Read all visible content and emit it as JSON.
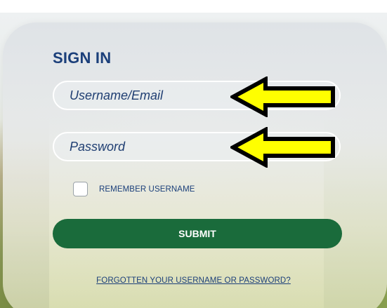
{
  "form": {
    "title": "SIGN IN",
    "username_placeholder": "Username/Email",
    "password_placeholder": "Password",
    "remember_label": "REMEMBER USERNAME",
    "remember_checked": false,
    "submit_label": "SUBMIT",
    "forgot_link": "FORGOTTEN YOUR USERNAME OR PASSWORD?"
  },
  "annotations": {
    "arrow_color": "#ffff00",
    "arrow_outline": "#000000",
    "arrow_icon": "left-arrow-icon"
  },
  "colors": {
    "title": "#1b3f7a",
    "submit_background": "#1a6b3b",
    "submit_text": "#ffffff"
  }
}
